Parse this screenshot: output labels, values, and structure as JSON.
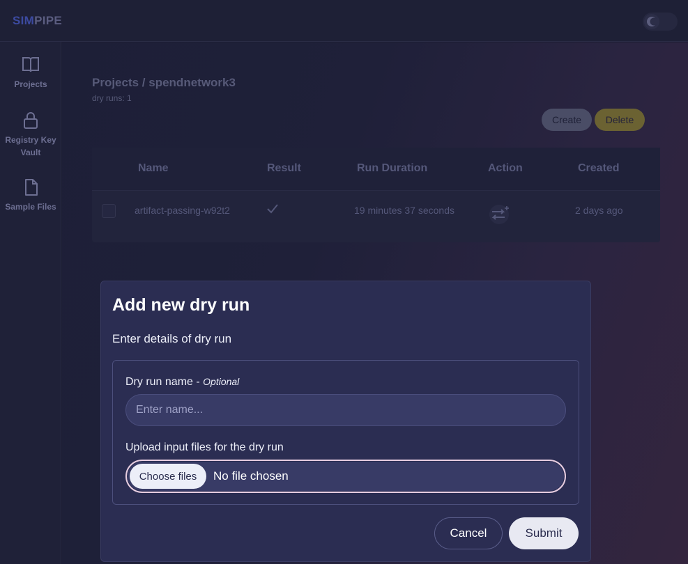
{
  "app": {
    "logo_part1": "SIM",
    "logo_part2": "PIPE",
    "theme_toggle_icon": "moon-icon"
  },
  "sidebar": {
    "items": [
      {
        "label": "Projects",
        "icon": "book-icon"
      },
      {
        "label_line1": "Registry Key",
        "label_line2": "Vault",
        "icon": "lock-icon"
      },
      {
        "label": "Sample Files",
        "icon": "file-icon"
      }
    ]
  },
  "header": {
    "breadcrumb": "Projects / spendnetwork3",
    "subtitle": "dry runs: 1"
  },
  "toolbar": {
    "create_label": "Create",
    "delete_label": "Delete"
  },
  "table": {
    "columns": [
      "Name",
      "Result",
      "Run Duration",
      "Action",
      "Created"
    ],
    "rows": [
      {
        "name": "artifact-passing-w92t2",
        "result_icon": "check-icon",
        "duration": "19 minutes 37 seconds",
        "action_icon": "rerun-icon",
        "created": "2 days ago"
      }
    ]
  },
  "modal": {
    "title": "Add new dry run",
    "description": "Enter details of dry run",
    "name_label": "Dry run name - ",
    "name_optional": "Optional",
    "name_placeholder": "Enter name...",
    "upload_label": "Upload input files for the dry run",
    "choose_files_label": "Choose files",
    "file_status": "No file chosen",
    "cancel_label": "Cancel",
    "submit_label": "Submit"
  },
  "colors": {
    "background": "#1c1d33",
    "modal_bg": "#2b2d52",
    "input_bg": "#383b66",
    "focus_ring": "#e7cde0",
    "delete_accent": "#6b6232"
  }
}
